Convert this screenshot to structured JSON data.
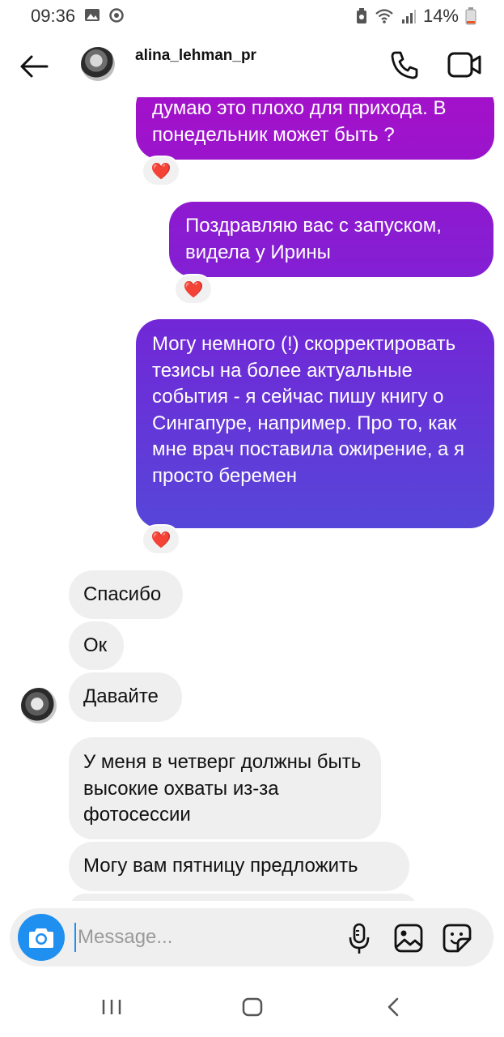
{
  "status_bar": {
    "time": "09:36",
    "battery": "14%"
  },
  "header": {
    "username": "alina_lehman_pr"
  },
  "messages": [
    {
      "id": "m1",
      "side": "out",
      "text": "думаю это плохо для прихода. В понедельник может быть ?",
      "reaction": "❤️"
    },
    {
      "id": "m2",
      "side": "out",
      "text": "Поздравляю вас с запуском, видела у Ирины",
      "reaction": "❤️"
    },
    {
      "id": "m3",
      "side": "out",
      "text": "Могу немного (!) скорректировать тезисы на более актуальные события - я сейчас пишу книгу о Сингапуре, например. Про то, как мне врач поставила ожирение, а я просто беремен",
      "reaction": "❤️"
    },
    {
      "id": "m4",
      "side": "in",
      "text": "Спасибо"
    },
    {
      "id": "m5",
      "side": "in",
      "text": "Ок"
    },
    {
      "id": "m6",
      "side": "in",
      "text": "Давайте"
    },
    {
      "id": "m7",
      "side": "in",
      "text": "У меня в четверг должны быть высокие охваты из-за фотосессии"
    },
    {
      "id": "m8",
      "side": "in",
      "text": "Могу вам пятницу предложить"
    }
  ],
  "composer": {
    "placeholder": "Message..."
  },
  "colors": {
    "gradient_top": "#9a12cc",
    "gradient_mid": "#7428d6",
    "gradient_bottom": "#5048d8",
    "incoming_bubble": "#efefef",
    "camera_button": "#1f8ff0",
    "reaction_heart": "#e8152a"
  },
  "icons": [
    "back-arrow-icon",
    "phone-icon",
    "video-camera-icon",
    "camera-icon",
    "microphone-icon",
    "gallery-icon",
    "sticker-icon",
    "heart-icon"
  ]
}
